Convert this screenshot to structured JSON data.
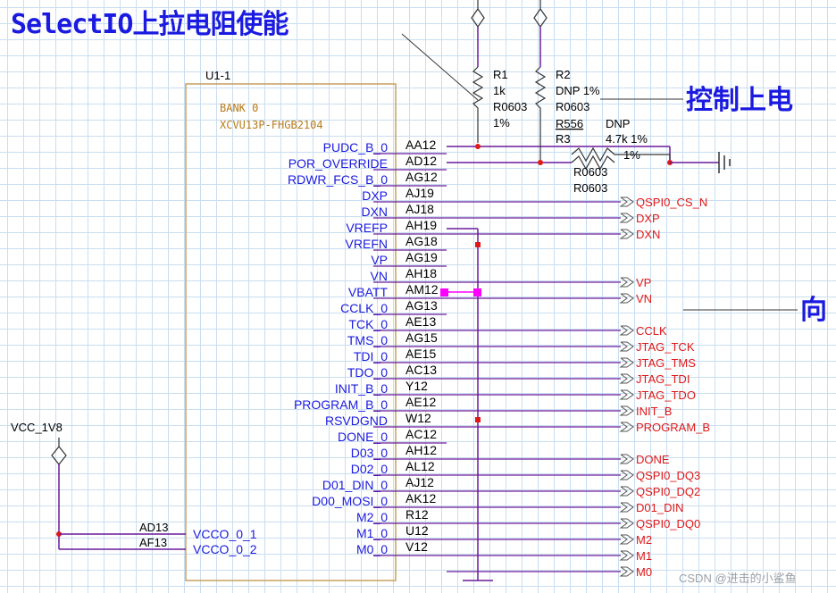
{
  "title": "SelectIO上拉电阻使能",
  "notes": {
    "right_top": "控制上电",
    "right_mid": "向"
  },
  "watermark": "CSDN @进击的小鲨鱼",
  "symbol": {
    "ref": "U1-1",
    "bank": "BANK 0",
    "part": "XCVU13P-FHGB2104"
  },
  "power": {
    "name": "VCC_1V8"
  },
  "resistors": [
    {
      "ref": "R1",
      "value": "1k",
      "pkg": "R0603",
      "tol": "1%"
    },
    {
      "ref": "R2",
      "value": "DNP 1%",
      "pkg": "R0603"
    },
    {
      "ref": "R3",
      "value": "4.7k 1%",
      "pkg": "R0603",
      "alt": "R556",
      "dnp": "DNP",
      "tol_label": "1%"
    }
  ],
  "r0603_extra": "R0603",
  "pins": [
    {
      "name": "PUDC_B_0",
      "num": "AA12",
      "net": ""
    },
    {
      "name": "POR_OVERRIDE",
      "num": "AD12",
      "net": ""
    },
    {
      "name": "RDWR_FCS_B_0",
      "num": "AG12",
      "net": ""
    },
    {
      "name": "DXP",
      "num": "AJ19",
      "net": "QSPI0_CS_N"
    },
    {
      "name": "DXN",
      "num": "AJ18",
      "net": "DXP"
    },
    {
      "name": "VREFP",
      "num": "AH19",
      "net": "DXN"
    },
    {
      "name": "VREFN",
      "num": "AG18",
      "net": ""
    },
    {
      "name": "VP",
      "num": "AG19",
      "net": ""
    },
    {
      "name": "VN",
      "num": "AH18",
      "net": "VP"
    },
    {
      "name": "VBATT",
      "num": "AM12",
      "net": "VN"
    },
    {
      "name": "CCLK_0",
      "num": "AG13",
      "net": ""
    },
    {
      "name": "TCK_0",
      "num": "AE13",
      "net": "CCLK"
    },
    {
      "name": "TMS_0",
      "num": "AG15",
      "net": "JTAG_TCK"
    },
    {
      "name": "TDI_0",
      "num": "AE15",
      "net": "JTAG_TMS"
    },
    {
      "name": "TDO_0",
      "num": "AC13",
      "net": "JTAG_TDI"
    },
    {
      "name": "INIT_B_0",
      "num": "Y12",
      "net": "JTAG_TDO"
    },
    {
      "name": "PROGRAM_B_0",
      "num": "AE12",
      "net": "INIT_B"
    },
    {
      "name": "RSVDGND",
      "num": "W12",
      "net": "PROGRAM_B"
    },
    {
      "name": "DONE_0",
      "num": "AC12",
      "net": ""
    },
    {
      "name": "D03_0",
      "num": "AH12",
      "net": "DONE"
    },
    {
      "name": "D02_0",
      "num": "AL12",
      "net": "QSPI0_DQ3"
    },
    {
      "name": "D01_DIN_0",
      "num": "AJ12",
      "net": "QSPI0_DQ2"
    },
    {
      "name": "D00_MOSI_0",
      "num": "AK12",
      "net": "D01_DIN"
    },
    {
      "name": "M2_0",
      "num": "R12",
      "net": "QSPI0_DQ0"
    },
    {
      "name": "M1_0",
      "num": "U12",
      "net": "M2"
    },
    {
      "name": "M0_0",
      "num": "V12",
      "net": "M1"
    }
  ],
  "last_net": "M0",
  "vcco": [
    {
      "name": "VCCO_0_1",
      "num": "AD13"
    },
    {
      "name": "VCCO_0_2",
      "num": "AF13"
    }
  ],
  "colors": {
    "wire": "#6a1a9a",
    "pin_text": "#1a1ae0",
    "net_text": "#e01818",
    "body": "#c8a060"
  }
}
